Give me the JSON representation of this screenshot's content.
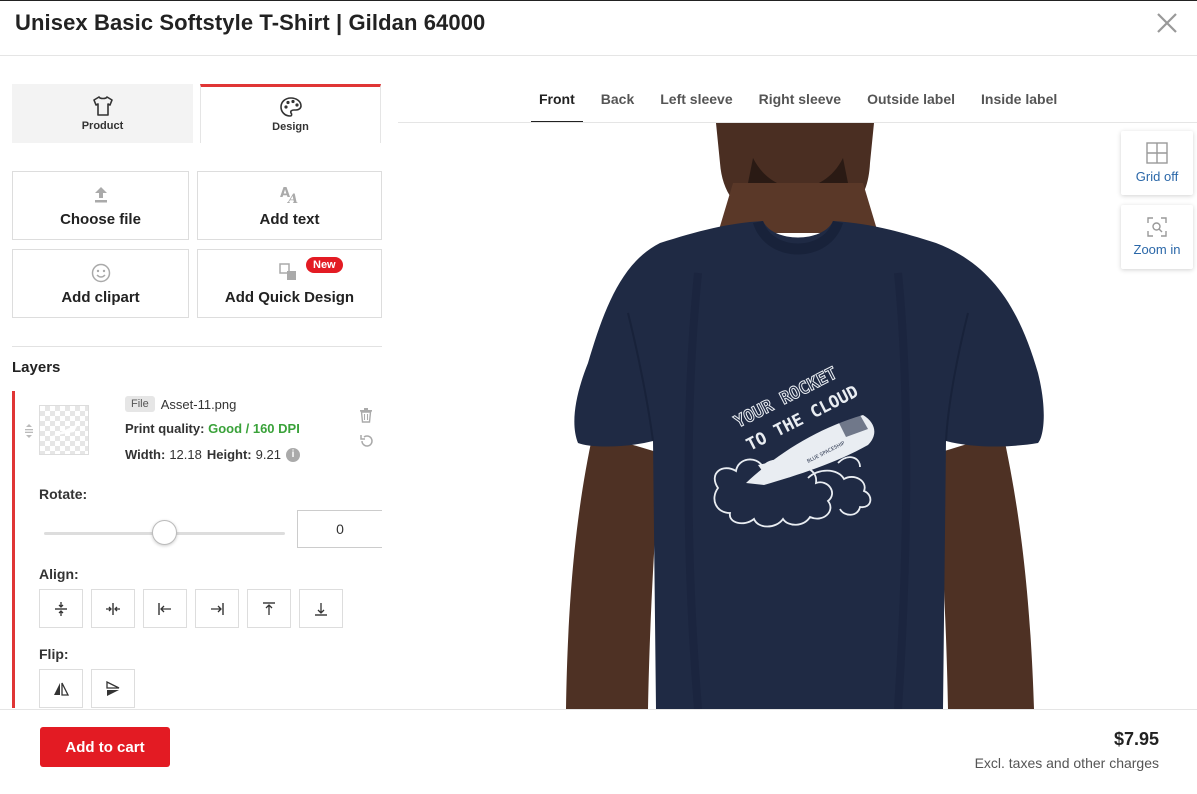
{
  "header": {
    "title": "Unisex Basic Softstyle T-Shirt | Gildan 64000"
  },
  "side_tabs": [
    {
      "label": "Product",
      "icon": "tshirt-icon"
    },
    {
      "label": "Design",
      "icon": "palette-icon",
      "active": true
    }
  ],
  "tools": {
    "choose_file": "Choose file",
    "add_text": "Add text",
    "add_clipart": "Add clipart",
    "add_quick_design": "Add Quick Design",
    "new_badge": "New"
  },
  "layers": {
    "title": "Layers",
    "items": [
      {
        "file_tag": "File",
        "file_name": "Asset-11.png",
        "print_quality_label": "Print quality:",
        "print_quality_value": "Good / 160 DPI",
        "width_label": "Width:",
        "width_value": "12.18",
        "height_label": "Height:",
        "height_value": "9.21",
        "rotate_label": "Rotate:",
        "rotate_value": "0",
        "align_label": "Align:",
        "flip_label": "Flip:"
      }
    ]
  },
  "view_tabs": [
    "Front",
    "Back",
    "Left sleeve",
    "Right sleeve",
    "Outside label",
    "Inside label"
  ],
  "canvas_tools": {
    "grid": "Grid off",
    "zoom": "Zoom in"
  },
  "design_print": {
    "line1": "YOUR ROCKET",
    "line2": "TO THE CLOUD",
    "small": "BLUE SPACESHIP"
  },
  "footer": {
    "add_to_cart": "Add to cart",
    "price": "$7.95",
    "price_note": "Excl. taxes and other charges"
  },
  "colors": {
    "accent_red": "#e31b23",
    "good_green": "#3aa23a",
    "link_blue": "#2a67a8",
    "shirt_navy": "#1f2a44"
  }
}
